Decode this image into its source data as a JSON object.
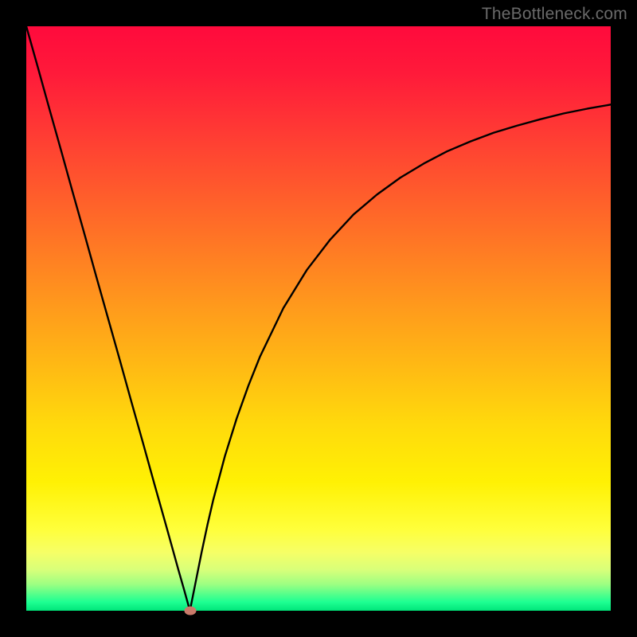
{
  "watermark": "TheBottleneck.com",
  "colors": {
    "frame": "#000000",
    "curve": "#000000",
    "dot": "#c97a6a"
  },
  "chart_data": {
    "type": "line",
    "title": "",
    "xlabel": "",
    "ylabel": "",
    "xlim": [
      0,
      100
    ],
    "ylim": [
      0,
      100
    ],
    "dip_x": 28,
    "x": [
      0,
      2,
      4,
      6,
      8,
      10,
      12,
      14,
      16,
      18,
      20,
      22,
      24,
      25,
      26,
      27,
      28,
      29,
      30,
      31,
      32,
      34,
      36,
      38,
      40,
      44,
      48,
      52,
      56,
      60,
      64,
      68,
      72,
      76,
      80,
      84,
      88,
      92,
      96,
      100
    ],
    "values": [
      100,
      92.9,
      85.7,
      78.6,
      71.4,
      64.3,
      57.1,
      50.0,
      42.9,
      35.7,
      28.6,
      21.4,
      14.3,
      10.7,
      7.1,
      3.6,
      0.0,
      5.0,
      10.0,
      14.7,
      19.0,
      26.5,
      32.9,
      38.5,
      43.5,
      51.8,
      58.3,
      63.5,
      67.8,
      71.2,
      74.1,
      76.5,
      78.6,
      80.3,
      81.8,
      83.0,
      84.1,
      85.1,
      85.9,
      86.6
    ],
    "annotations": [
      {
        "type": "dot",
        "x": 28,
        "y": 0
      }
    ]
  }
}
